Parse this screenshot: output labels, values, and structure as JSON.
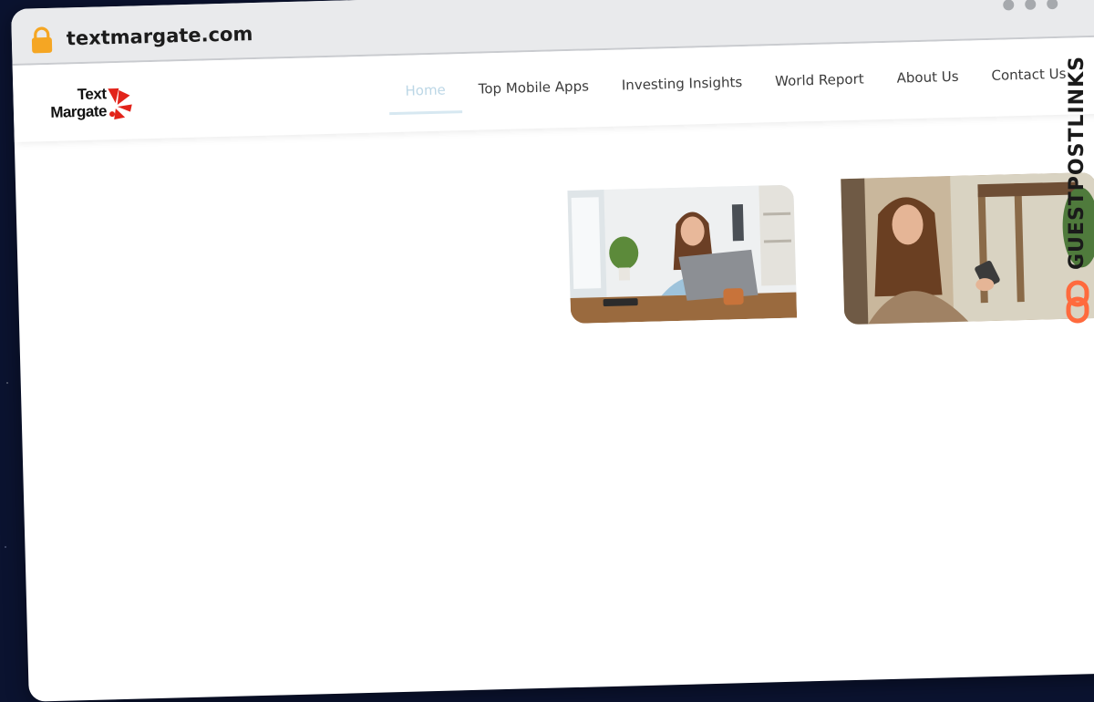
{
  "browser": {
    "url": "textmargate.com"
  },
  "site": {
    "logo_line1": "Text",
    "logo_line2": "Margate",
    "nav": [
      {
        "label": "Home",
        "active": true
      },
      {
        "label": "Top Mobile Apps"
      },
      {
        "label": "Investing Insights"
      },
      {
        "label": "World Report"
      },
      {
        "label": "About Us"
      },
      {
        "label": "Contact Us"
      }
    ]
  },
  "watermark": {
    "text": "GUESTPOSTLINKS"
  },
  "icons": {
    "lock": "lock-icon",
    "window_controls": "window-dots-icon",
    "logo_mark": "logo-burst-icon",
    "watermark_link": "link-icon"
  },
  "colors": {
    "lock": "#f5a623",
    "logo_red": "#e2231a",
    "nav_active": "#bcd7e6",
    "watermark_accent": "#ff6a3d"
  }
}
